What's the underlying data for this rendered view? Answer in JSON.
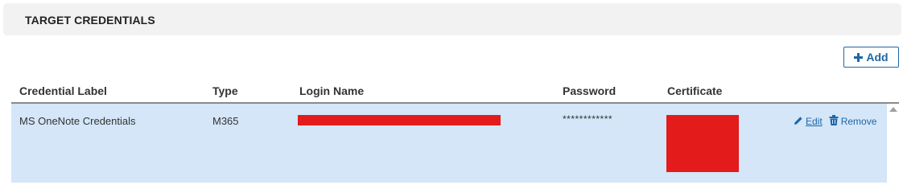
{
  "section": {
    "title": "TARGET CREDENTIALS"
  },
  "toolbar": {
    "add_label": "Add"
  },
  "table": {
    "columns": [
      "Credential Label",
      "Type",
      "Login Name",
      "Password",
      "Certificate"
    ],
    "rows": [
      {
        "label": "MS OneNote Credentials",
        "type": "M365",
        "password": "************",
        "actions": {
          "edit": "Edit",
          "remove": "Remove"
        }
      }
    ]
  },
  "icons": {
    "add": "plus-icon",
    "edit": "pencil-icon",
    "remove": "trash-icon",
    "scroll": "scroll-up-arrow-icon"
  },
  "colors": {
    "accent": "#1f66a8",
    "selected_row": "#d4e6f8",
    "header_bg": "#f2f2f2",
    "redaction": "#e31b1b"
  }
}
